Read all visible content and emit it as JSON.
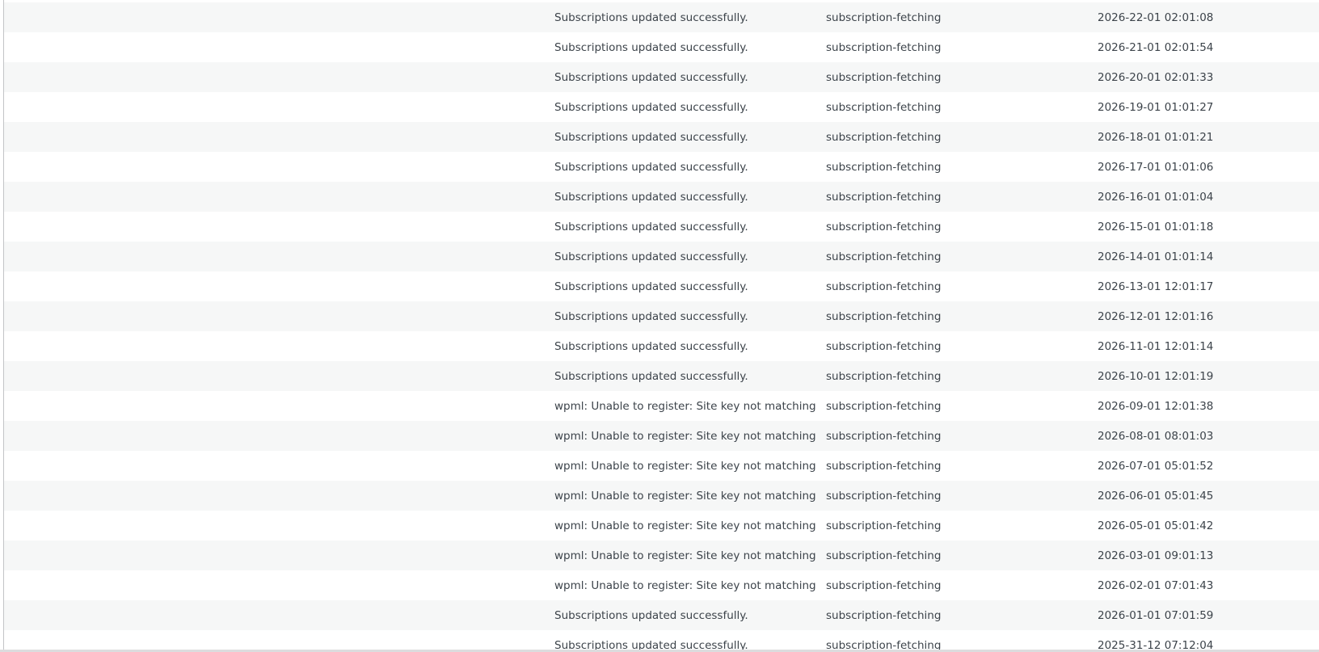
{
  "log": {
    "rows": [
      {
        "message": "Subscriptions updated successfully.",
        "source": "subscription-fetching",
        "date": "2026-22-01 02:01:08"
      },
      {
        "message": "Subscriptions updated successfully.",
        "source": "subscription-fetching",
        "date": "2026-21-01 02:01:54"
      },
      {
        "message": "Subscriptions updated successfully.",
        "source": "subscription-fetching",
        "date": "2026-20-01 02:01:33"
      },
      {
        "message": "Subscriptions updated successfully.",
        "source": "subscription-fetching",
        "date": "2026-19-01 01:01:27"
      },
      {
        "message": "Subscriptions updated successfully.",
        "source": "subscription-fetching",
        "date": "2026-18-01 01:01:21"
      },
      {
        "message": "Subscriptions updated successfully.",
        "source": "subscription-fetching",
        "date": "2026-17-01 01:01:06"
      },
      {
        "message": "Subscriptions updated successfully.",
        "source": "subscription-fetching",
        "date": "2026-16-01 01:01:04"
      },
      {
        "message": "Subscriptions updated successfully.",
        "source": "subscription-fetching",
        "date": "2026-15-01 01:01:18"
      },
      {
        "message": "Subscriptions updated successfully.",
        "source": "subscription-fetching",
        "date": "2026-14-01 01:01:14"
      },
      {
        "message": "Subscriptions updated successfully.",
        "source": "subscription-fetching",
        "date": "2026-13-01 12:01:17"
      },
      {
        "message": "Subscriptions updated successfully.",
        "source": "subscription-fetching",
        "date": "2026-12-01 12:01:16"
      },
      {
        "message": "Subscriptions updated successfully.",
        "source": "subscription-fetching",
        "date": "2026-11-01 12:01:14"
      },
      {
        "message": "Subscriptions updated successfully.",
        "source": "subscription-fetching",
        "date": "2026-10-01 12:01:19"
      },
      {
        "message": "wpml: Unable to register: Site key not matching",
        "source": "subscription-fetching",
        "date": "2026-09-01 12:01:38"
      },
      {
        "message": "wpml: Unable to register: Site key not matching",
        "source": "subscription-fetching",
        "date": "2026-08-01 08:01:03"
      },
      {
        "message": "wpml: Unable to register: Site key not matching",
        "source": "subscription-fetching",
        "date": "2026-07-01 05:01:52"
      },
      {
        "message": "wpml: Unable to register: Site key not matching",
        "source": "subscription-fetching",
        "date": "2026-06-01 05:01:45"
      },
      {
        "message": "wpml: Unable to register: Site key not matching",
        "source": "subscription-fetching",
        "date": "2026-05-01 05:01:42"
      },
      {
        "message": "wpml: Unable to register: Site key not matching",
        "source": "subscription-fetching",
        "date": "2026-03-01 09:01:13"
      },
      {
        "message": "wpml: Unable to register: Site key not matching",
        "source": "subscription-fetching",
        "date": "2026-02-01 07:01:43"
      },
      {
        "message": "Subscriptions updated successfully.",
        "source": "subscription-fetching",
        "date": "2026-01-01 07:01:59"
      },
      {
        "message": "Subscriptions updated successfully.",
        "source": "subscription-fetching",
        "date": "2025-31-12 07:12:04"
      }
    ]
  }
}
